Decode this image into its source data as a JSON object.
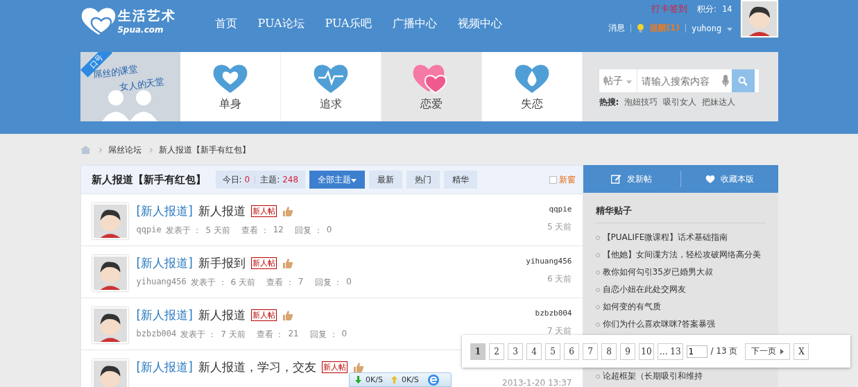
{
  "logo": {
    "title": "生活艺术",
    "domain": "5pua.com"
  },
  "nav": [
    {
      "label": "首页"
    },
    {
      "label": "PUA论坛"
    },
    {
      "label": "PUA乐吧"
    },
    {
      "label": "广播中心"
    },
    {
      "label": "视频中心"
    }
  ],
  "user": {
    "checkin": "打卡签到",
    "points_label": "积分:",
    "points": "14",
    "messages": "消息",
    "reminder": "提醒(1)",
    "username": "yuhong"
  },
  "banner": {
    "ribbon": "口号",
    "line_1": "屌丝的课堂",
    "line_2": "女人的天堂"
  },
  "categories": [
    {
      "label": "单身",
      "kind": "heart",
      "selected": false
    },
    {
      "label": "追求",
      "kind": "pulse",
      "selected": false
    },
    {
      "label": "恋爱",
      "kind": "hearts",
      "selected": true
    },
    {
      "label": "失恋",
      "kind": "drop",
      "selected": false
    }
  ],
  "search": {
    "scope": "帖子",
    "placeholder": "请输入搜索内容",
    "hot_label": "热搜:",
    "hot": [
      "泡妞技巧",
      "吸引女人",
      "把妹达人"
    ]
  },
  "breadcrumb": [
    "屌丝论坛",
    "新人报道【新手有红包】"
  ],
  "forum": {
    "title": "新人报道【新手有红包】",
    "today_label": "今日:",
    "today": "0",
    "topics_label": "主题:",
    "topics": "248",
    "filters": [
      {
        "label": "全部主题",
        "selected": true
      },
      {
        "label": "最新",
        "selected": false
      },
      {
        "label": "热门",
        "selected": false
      },
      {
        "label": "精华",
        "selected": false
      }
    ],
    "new_window": {
      "label": "新窗",
      "checked": false
    }
  },
  "threads": [
    {
      "category": "[新人报道]",
      "title": "新人报道",
      "badge": "新人帖",
      "author": "qqpie",
      "posted_label": "发表于 ：",
      "posted": "5 天前",
      "views_label": "查看 ：",
      "views": "12",
      "replies_label": "回复 ：",
      "replies": "0",
      "last_author": "qqpie",
      "last_time": "5 天前"
    },
    {
      "category": "[新人报道]",
      "title": "新手报到",
      "badge": "新人帖",
      "author": "yihuang456",
      "posted_label": "发表于 ：",
      "posted": "6 天前",
      "views_label": "查看 ：",
      "views": "7",
      "replies_label": "回复 ：",
      "replies": "0",
      "last_author": "yihuang456",
      "last_time": "6 天前"
    },
    {
      "category": "[新人报道]",
      "title": "新人报道",
      "badge": "新人帖",
      "author": "bzbzb004",
      "posted_label": "发表于 ：",
      "posted": "7 天前",
      "views_label": "查看 ：",
      "views": "21",
      "replies_label": "回复 ：",
      "replies": "0",
      "last_author": "bzbzb004",
      "last_time": "7 天前"
    },
    {
      "category": "[新人报道]",
      "title": "新人报道，学习，交友",
      "badge": "新人帖",
      "last_time": "2013-1-20 13:37"
    }
  ],
  "sidebar": {
    "new_post": "发新帖",
    "favorite": "收藏本版",
    "featured_title": "精华贴子",
    "featured": [
      "【PUALIFE微课程】话术基础指南",
      "【他她】女间谍方法，轻松攻破网络高分美",
      "教你如何勾引35岁已婚男大叔",
      "自恋小妞在此处交网友",
      "如何变的有气质",
      "你们为什么喜欢咪咪?答案暴强"
    ],
    "featured_below": [
      "论超框架（长期吸引和维持"
    ]
  },
  "pager": {
    "pages": [
      {
        "label": "1",
        "selected": true
      },
      {
        "label": "2",
        "selected": false
      },
      {
        "label": "3",
        "selected": false
      },
      {
        "label": "4",
        "selected": false
      },
      {
        "label": "5",
        "selected": false
      },
      {
        "label": "6",
        "selected": false
      },
      {
        "label": "7",
        "selected": false
      },
      {
        "label": "8",
        "selected": false
      },
      {
        "label": "9",
        "selected": false
      },
      {
        "label": "10",
        "selected": false
      },
      {
        "label": "... 13",
        "selected": false
      }
    ],
    "input": "1",
    "total": "/ 13 页",
    "next": "下一页",
    "close": "X"
  },
  "speed": {
    "down": "0K/S",
    "up": "0K/S"
  }
}
